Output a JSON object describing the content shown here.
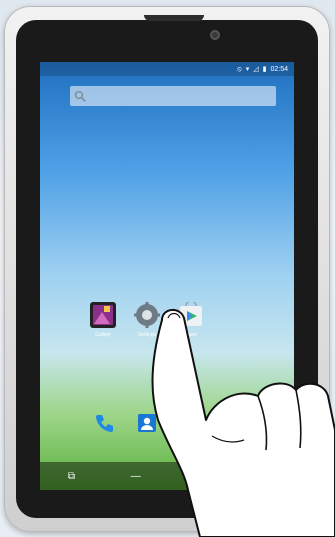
{
  "status_bar": {
    "time": "02:54",
    "icons": [
      "do-not-disturb-icon",
      "wifi-icon",
      "signal-icon",
      "battery-icon"
    ]
  },
  "search": {
    "placeholder": ""
  },
  "apps": [
    {
      "label": "Gallery",
      "icon": "gallery-icon"
    },
    {
      "label": "Settings",
      "icon": "settings-gear-icon"
    },
    {
      "label": "Store",
      "icon": "play-store-icon"
    }
  ],
  "dock": [
    {
      "icon": "phone-icon",
      "color": "#1e88e5"
    },
    {
      "icon": "contacts-icon",
      "color": "#1976d2"
    },
    {
      "icon": "app-drawer-icon",
      "color": "#ffffff"
    },
    {
      "icon": "hidden-app-icon",
      "color": "#1e88e5"
    }
  ],
  "navigation": [
    {
      "icon": "screenshot-icon",
      "glyph": "⧉"
    },
    {
      "icon": "volume-down-icon",
      "glyph": "—"
    },
    {
      "icon": "back-icon",
      "glyph": "◁"
    },
    {
      "icon": "home-icon",
      "glyph": "○"
    }
  ],
  "colors": {
    "accent": "#1e88e5",
    "frame": "#1a1a1a"
  }
}
